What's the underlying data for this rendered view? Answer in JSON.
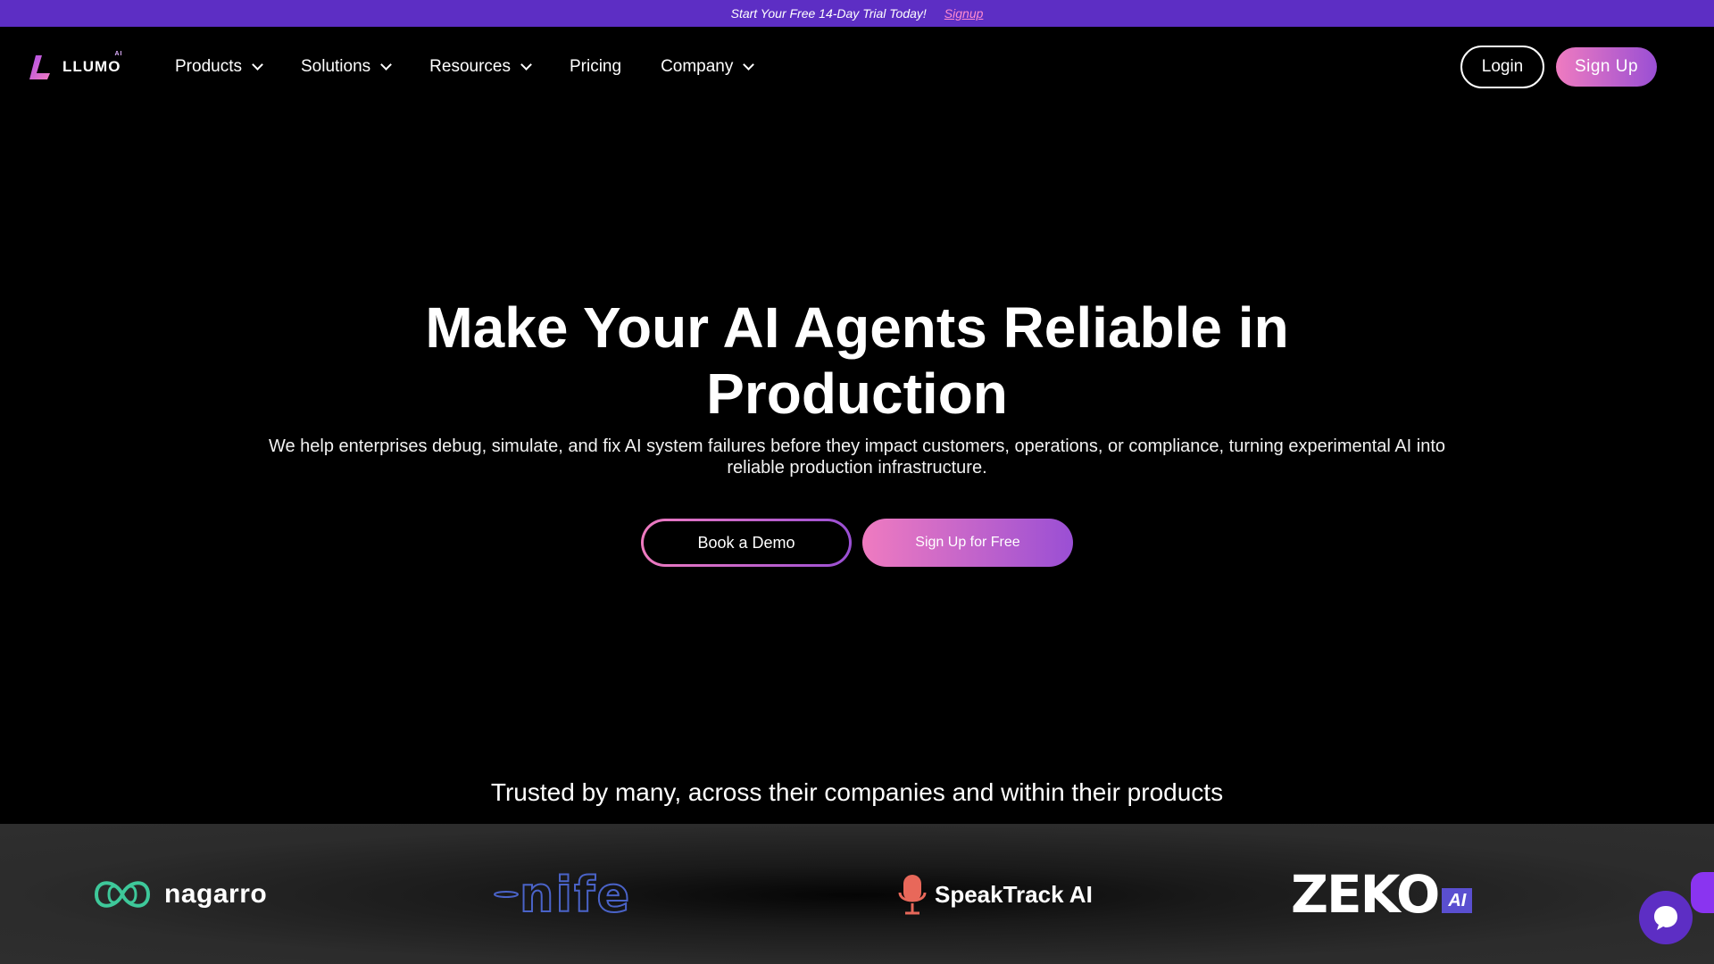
{
  "promo": {
    "text": "Start Your Free 14-Day Trial Today!",
    "link": "Signup"
  },
  "logo": {
    "text": "LLUMO",
    "superscript": "AI"
  },
  "nav": {
    "items": [
      {
        "label": "Products",
        "has_dropdown": true
      },
      {
        "label": "Solutions",
        "has_dropdown": true
      },
      {
        "label": "Resources",
        "has_dropdown": true
      },
      {
        "label": "Pricing",
        "has_dropdown": false
      },
      {
        "label": "Company",
        "has_dropdown": true
      }
    ],
    "login_label": "Login",
    "signup_label": "Sign Up"
  },
  "hero": {
    "title": "Make Your AI Agents Reliable in Production",
    "subtitle": "We help enterprises debug, simulate, and fix AI system failures before they impact customers, operations, or compliance, turning experimental AI into reliable production infrastructure.",
    "demo_label": "Book a Demo",
    "free_label": "Sign Up for Free"
  },
  "trusted": {
    "heading": "Trusted by many, across their companies and within their products",
    "brands": [
      "nagarro",
      "nife",
      "SpeakTrack AI",
      "ZEKO",
      "AI"
    ]
  },
  "colors": {
    "promo_bg": "#5d2ec4",
    "accent_pink": "#ef7bc0",
    "accent_purple": "#9a4fd4",
    "nagarro_green": "#3ec89a",
    "nife_blue": "#4a63c8",
    "speaktrack_red": "#e8685a",
    "zeko_badge": "#5a4fd0"
  },
  "icons": [
    "llumo-logo-icon",
    "chevron-down-icon",
    "nagarro-logo-icon",
    "microphone-icon",
    "chat-icon"
  ]
}
